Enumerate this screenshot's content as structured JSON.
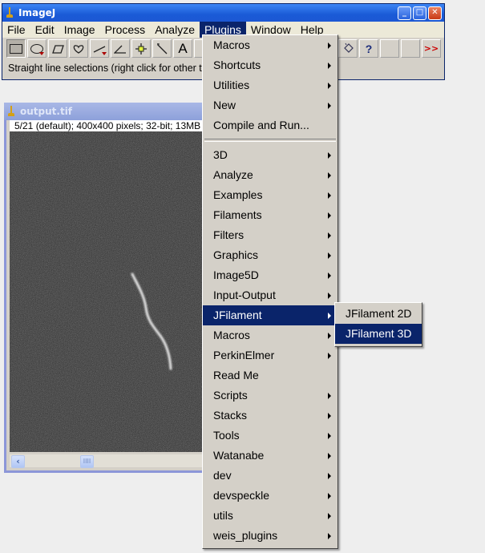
{
  "main_window": {
    "title": "ImageJ",
    "controls": {
      "minimize": "_",
      "maximize": "□",
      "close": "✕"
    },
    "menubar": [
      "File",
      "Edit",
      "Image",
      "Process",
      "Analyze",
      "Plugins",
      "Window",
      "Help"
    ],
    "active_menu": "Plugins",
    "tools": [
      {
        "name": "rectangle-tool",
        "glyph": "▭",
        "pressed": true
      },
      {
        "name": "oval-tool",
        "glyph": "◯",
        "dropdown": true
      },
      {
        "name": "polygon-tool",
        "glyph": "⏢"
      },
      {
        "name": "freehand-tool",
        "glyph": "♡"
      },
      {
        "name": "line-tool",
        "glyph": "⁄",
        "dropdown": true
      },
      {
        "name": "angle-tool",
        "glyph": "∠"
      },
      {
        "name": "point-tool",
        "glyph": "✛"
      },
      {
        "name": "wand-tool",
        "glyph": "⟍"
      },
      {
        "name": "text-tool",
        "glyph": "A"
      }
    ],
    "tools_right": [
      {
        "name": "dropper-tool",
        "glyph": "🪣"
      },
      {
        "name": "help-tool",
        "glyph": "?"
      },
      {
        "name": "blank-tool-1",
        "glyph": ""
      },
      {
        "name": "blank-tool-2",
        "glyph": ""
      },
      {
        "name": "more-tools",
        "glyph": ">>"
      }
    ],
    "status": "Straight line selections (right click for other ty"
  },
  "image_window": {
    "title": "output.tif",
    "info": "5/21 (default); 400x400 pixels; 32-bit; 13MB",
    "scroll_left": "‹",
    "scroll_thumb": "IIII"
  },
  "plugins_menu": {
    "items": [
      {
        "label": "Macros",
        "submenu": true
      },
      {
        "label": "Shortcuts",
        "submenu": true
      },
      {
        "label": "Utilities",
        "submenu": true
      },
      {
        "label": "New",
        "submenu": true
      },
      {
        "label": "Compile and Run...",
        "submenu": false
      },
      {
        "separator": true
      },
      {
        "label": "3D",
        "submenu": true
      },
      {
        "label": "Analyze",
        "submenu": true
      },
      {
        "label": "Examples",
        "submenu": true
      },
      {
        "label": "Filaments",
        "submenu": true
      },
      {
        "label": "Filters",
        "submenu": true
      },
      {
        "label": "Graphics",
        "submenu": true
      },
      {
        "label": "Image5D",
        "submenu": true
      },
      {
        "label": "Input-Output",
        "submenu": true
      },
      {
        "label": "JFilament",
        "submenu": true,
        "selected": true
      },
      {
        "label": "Macros",
        "submenu": true
      },
      {
        "label": "PerkinElmer",
        "submenu": true
      },
      {
        "label": "Read Me",
        "submenu": false
      },
      {
        "label": "Scripts",
        "submenu": true
      },
      {
        "label": "Stacks",
        "submenu": true
      },
      {
        "label": "Tools",
        "submenu": true
      },
      {
        "label": "Watanabe",
        "submenu": true
      },
      {
        "label": "dev",
        "submenu": true
      },
      {
        "label": "devspeckle",
        "submenu": true
      },
      {
        "label": "utils",
        "submenu": true
      },
      {
        "label": "weis_plugins",
        "submenu": true
      }
    ]
  },
  "jfilament_submenu": {
    "items": [
      {
        "label": "JFilament 2D",
        "selected": false
      },
      {
        "label": "JFilament 3D",
        "selected": true
      }
    ]
  },
  "colors": {
    "selection": "#0a246a",
    "menu_bg": "#d4d0c8",
    "title_active": "#1a5ad6"
  }
}
